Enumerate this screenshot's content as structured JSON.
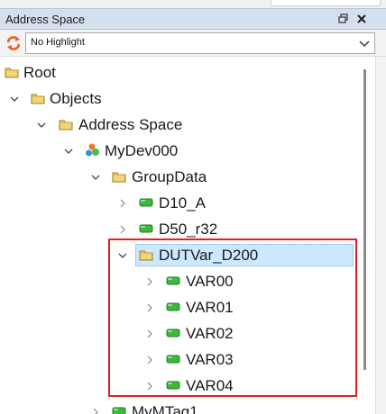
{
  "panel": {
    "title": "Address Space"
  },
  "toolbar": {
    "highlight_value": "No Highlight"
  },
  "colors": {
    "titlebar": "#d5e0ee",
    "selection": "#cce8ff",
    "annotation_box": "#e02020",
    "tag_icon": "#3cb83c",
    "folder_icon": "#e8c45a"
  },
  "tree": [
    {
      "label": "Root",
      "icon": "folder-icon",
      "expander": "none"
    },
    {
      "label": "Objects",
      "icon": "folder-icon",
      "expander": "expanded"
    },
    {
      "label": "Address Space",
      "icon": "folder-icon",
      "expander": "expanded"
    },
    {
      "label": "MyDev000",
      "icon": "device-icon",
      "expander": "expanded"
    },
    {
      "label": "GroupData",
      "icon": "folder-icon",
      "expander": "expanded"
    },
    {
      "label": "D10_A",
      "icon": "tag-icon",
      "expander": "collapsed"
    },
    {
      "label": "D50_r32",
      "icon": "tag-icon",
      "expander": "collapsed"
    },
    {
      "label": "DUTVar_D200",
      "icon": "folder-icon",
      "expander": "expanded",
      "selected": true
    },
    {
      "label": "VAR00",
      "icon": "tag-icon",
      "expander": "collapsed"
    },
    {
      "label": "VAR01",
      "icon": "tag-icon",
      "expander": "collapsed"
    },
    {
      "label": "VAR02",
      "icon": "tag-icon",
      "expander": "collapsed"
    },
    {
      "label": "VAR03",
      "icon": "tag-icon",
      "expander": "collapsed"
    },
    {
      "label": "VAR04",
      "icon": "tag-icon",
      "expander": "collapsed"
    },
    {
      "label": "MyMTag1",
      "icon": "tag-icon",
      "expander": "collapsed"
    }
  ]
}
